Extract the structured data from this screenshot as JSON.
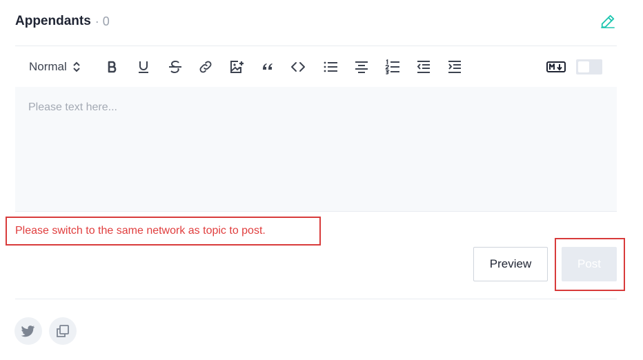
{
  "header": {
    "title": "Appendants",
    "separator": "·",
    "count": "0",
    "edit_icon": "pencil-icon"
  },
  "toolbar": {
    "format": "Normal",
    "buttons": [
      "bold-icon",
      "underline-icon",
      "strikethrough-icon",
      "link-icon",
      "image-icon",
      "quote-icon",
      "code-icon",
      "bullet-list-icon",
      "align-center-icon",
      "ordered-list-icon",
      "outdent-icon",
      "indent-icon"
    ],
    "markdown_label": "M↓",
    "markdown_toggle": "off"
  },
  "editor": {
    "placeholder": "Please text here..."
  },
  "error": {
    "message": "Please switch to the same network as topic to post."
  },
  "actions": {
    "preview_label": "Preview",
    "post_label": "Post"
  },
  "share": {
    "items": [
      "twitter-icon",
      "copy-icon"
    ]
  },
  "colors": {
    "accent": "#1fc6b0",
    "error": "#e03d3d",
    "disabled_button": "#e7ebf1",
    "editor_bg": "#f7f9fb"
  }
}
